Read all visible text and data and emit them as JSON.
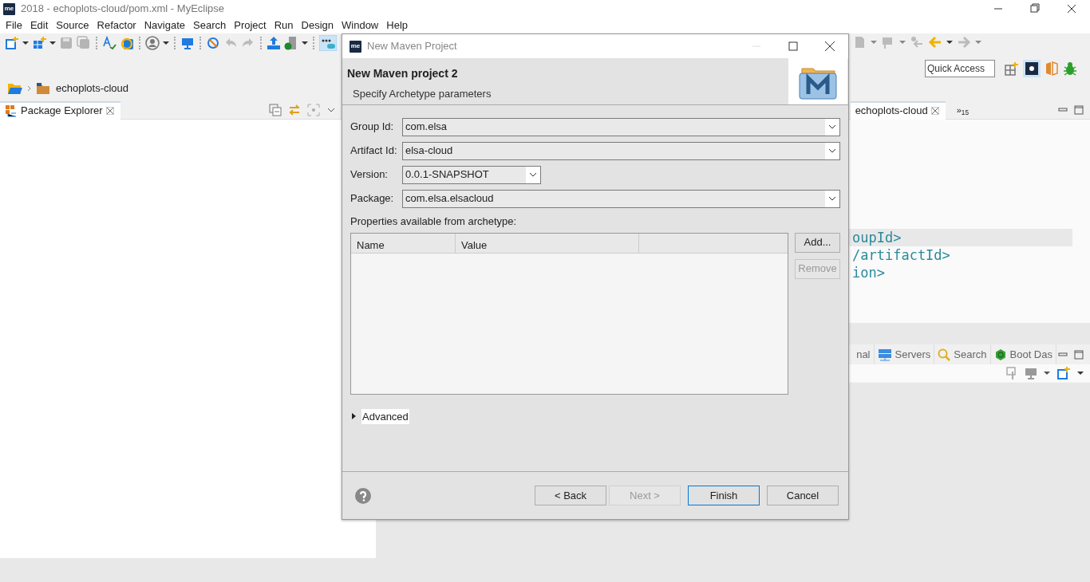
{
  "window": {
    "logo": "me",
    "title": "2018 - echoplots-cloud/pom.xml - MyEclipse"
  },
  "menu": [
    "File",
    "Edit",
    "Source",
    "Refactor",
    "Navigate",
    "Search",
    "Project",
    "Run",
    "Design",
    "Window",
    "Help"
  ],
  "quick_access": {
    "placeholder": "Quick Access"
  },
  "breadcrumb": [
    "echoplots-cloud"
  ],
  "package_explorer": {
    "title": "Package Explorer"
  },
  "editor": {
    "tab": "echoplots-cloud",
    "overflow_mark": "»",
    "overflow_count": "15",
    "lines": [
      {
        "text": "oupId>",
        "highlighted": true
      },
      {
        "text": "/artifactId>",
        "highlighted": false
      },
      {
        "text": "ion>",
        "highlighted": false
      }
    ]
  },
  "bottom_panel": {
    "tabs": [
      {
        "label": "nal",
        "kind": "plain"
      },
      {
        "label": "Servers",
        "kind": "servers"
      },
      {
        "label": "Search",
        "kind": "search"
      },
      {
        "label": "Boot Das",
        "kind": "boot"
      }
    ]
  },
  "dialog": {
    "logo": "me",
    "title": "New Maven Project",
    "heading": "New Maven project 2",
    "subheading": "Specify Archetype parameters",
    "fields": [
      {
        "label": "Group Id:",
        "value": "com.elsa",
        "wide": true
      },
      {
        "label": "Artifact Id:",
        "value": "elsa-cloud",
        "wide": true
      },
      {
        "label": "Version:",
        "value": "0.0.1-SNAPSHOT",
        "wide": false
      },
      {
        "label": "Package:",
        "value": "com.elsa.elsacloud",
        "wide": true
      }
    ],
    "properties_label": "Properties available from archetype:",
    "table": {
      "columns": [
        "Name",
        "Value"
      ]
    },
    "side_buttons": [
      {
        "label": "Add...",
        "disabled": false
      },
      {
        "label": "Remove",
        "disabled": true
      }
    ],
    "advanced": {
      "label": "Advanced",
      "expanded": false
    },
    "buttons": [
      {
        "label": "< Back",
        "disabled": false,
        "default": false
      },
      {
        "label": "Next >",
        "disabled": true,
        "default": false
      },
      {
        "label": "Finish",
        "disabled": false,
        "default": true
      },
      {
        "label": "Cancel",
        "disabled": false,
        "default": false
      }
    ]
  }
}
